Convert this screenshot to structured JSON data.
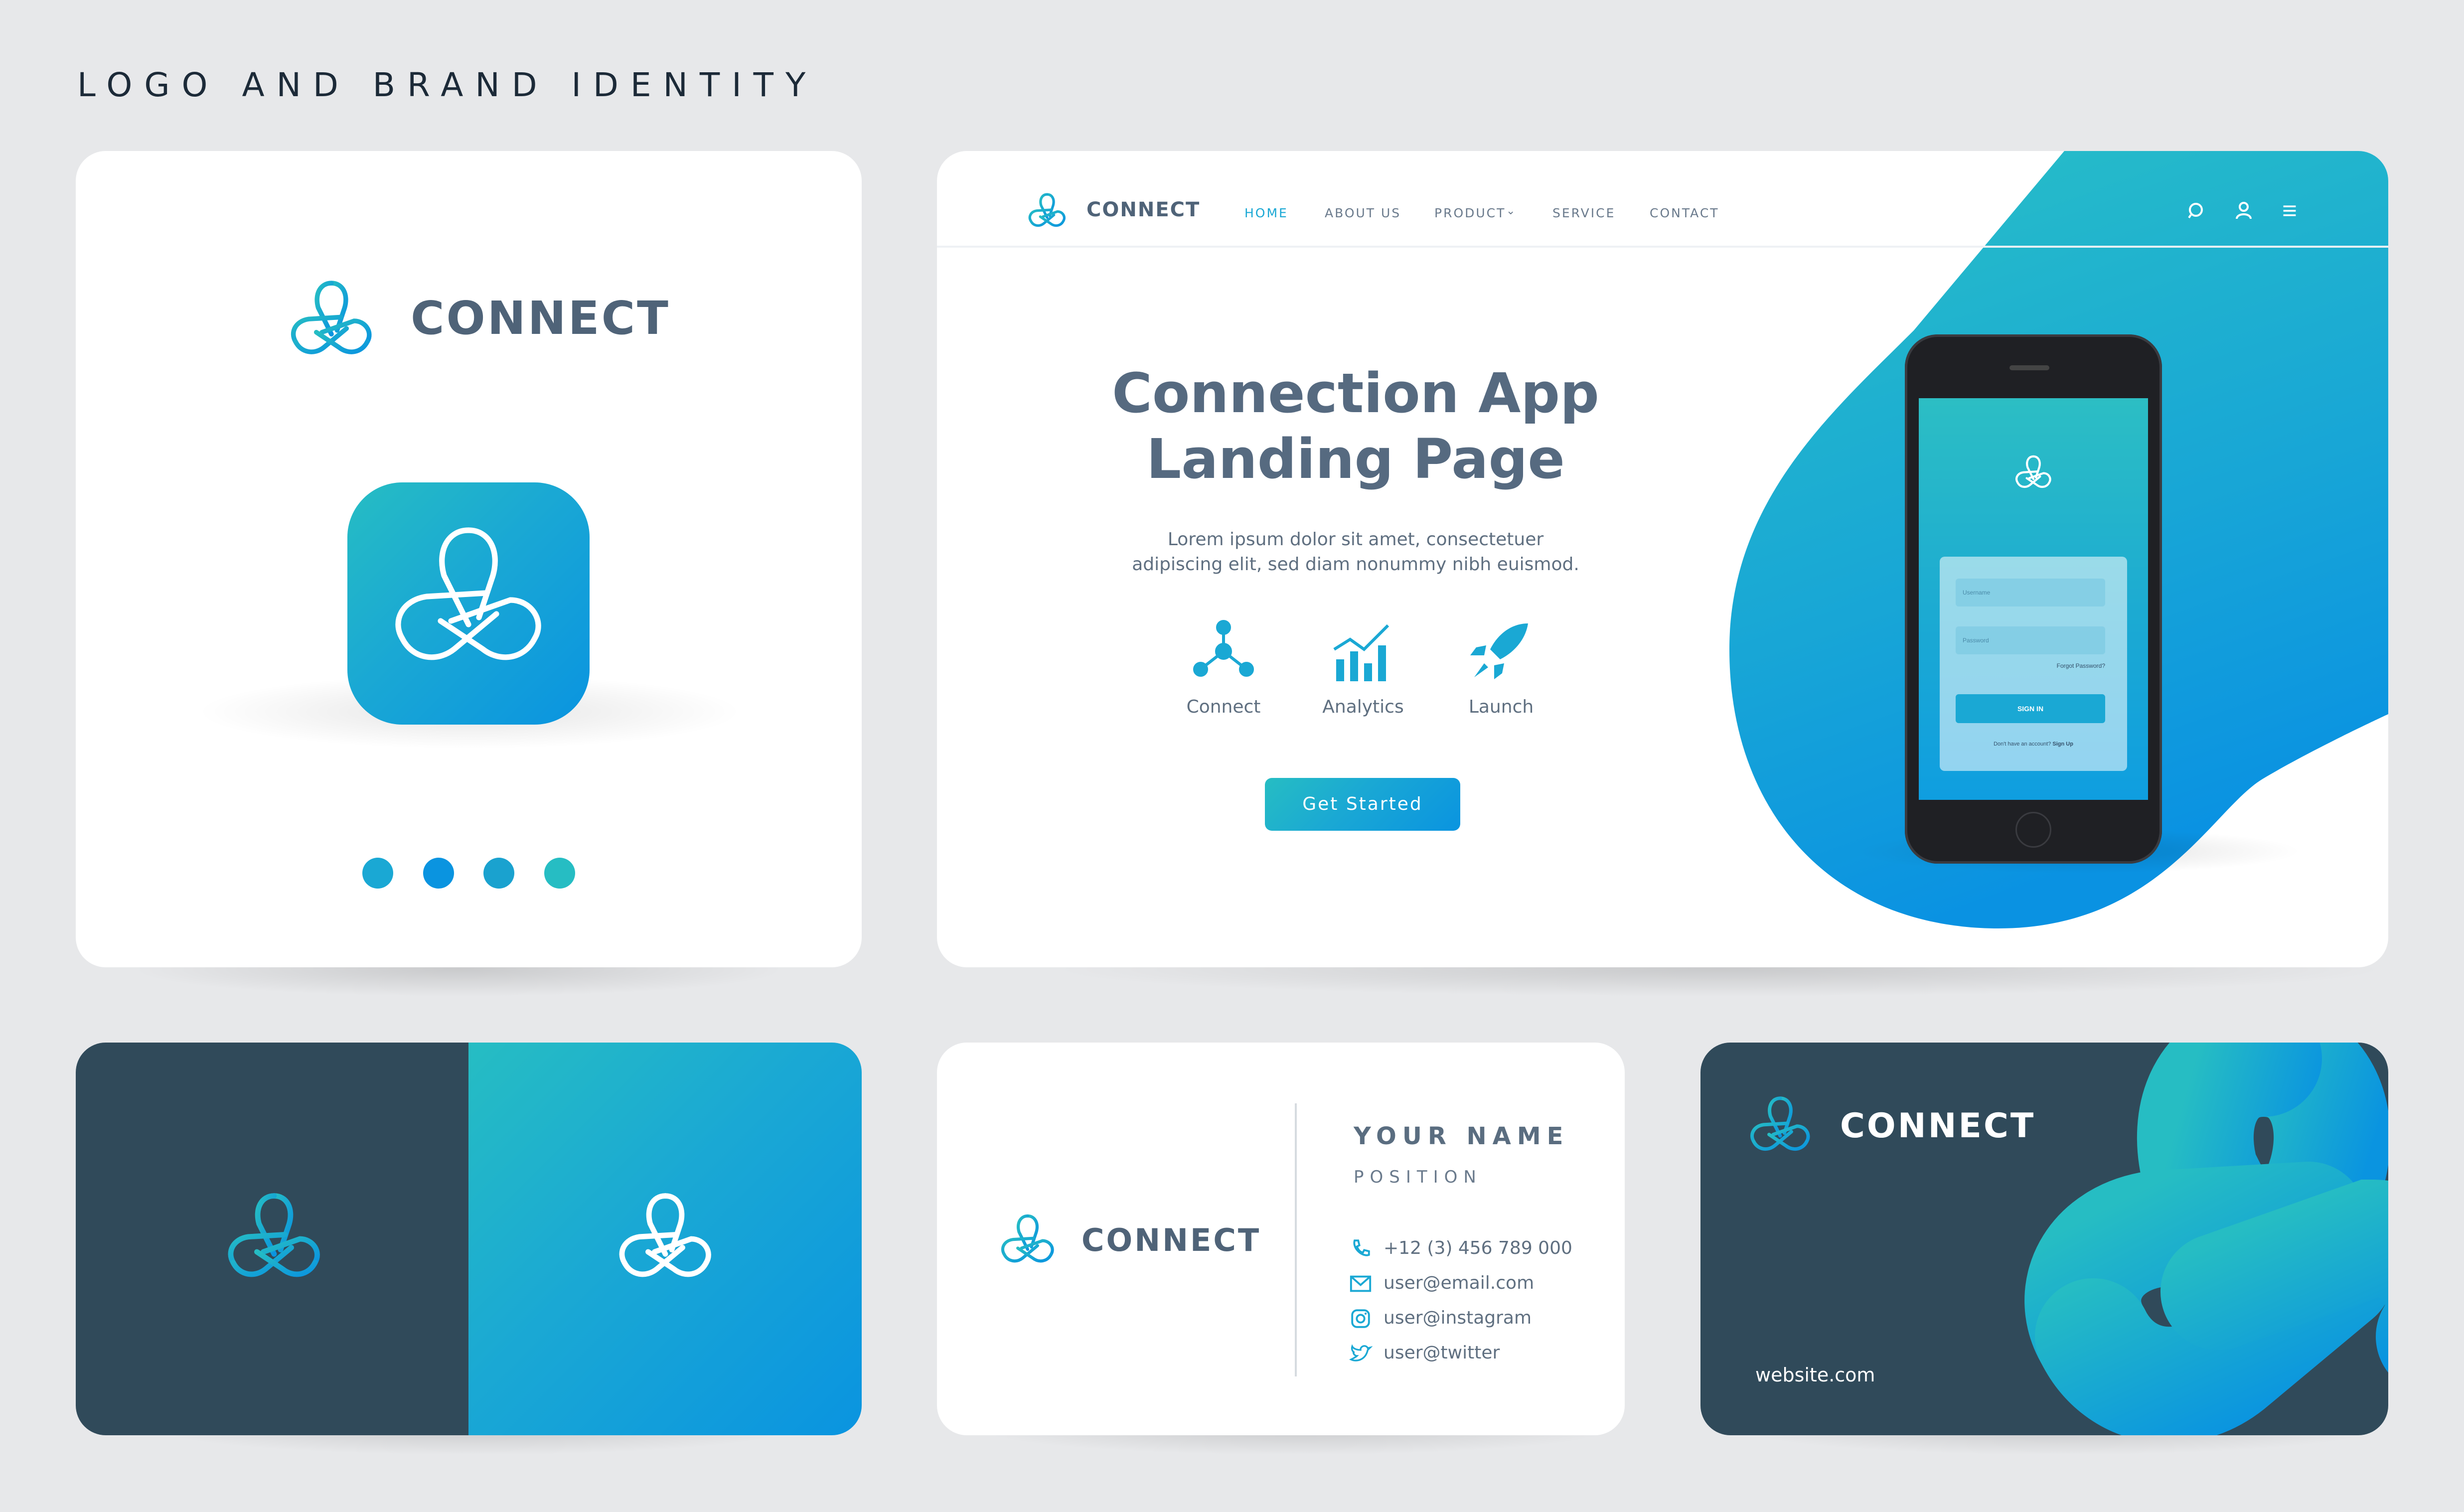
{
  "heading": "LOGO AND BRAND IDENTITY",
  "brand": {
    "name": "CONNECT",
    "colors": {
      "accent": "#1aa8d4",
      "teal": "#26bdc3",
      "blue": "#0a94e0",
      "dark": "#304a5a",
      "text": "#4f6378"
    }
  },
  "palette_dots": [
    "#1aa8d4",
    "#0a94e0",
    "#1aa2cf",
    "#26bdc3"
  ],
  "website": {
    "nav": {
      "home": "HOME",
      "about": "ABOUT US",
      "product": "PRODUCT",
      "service": "SERVICE",
      "contact": "CONTACT"
    },
    "hero_title_1": "Connection App",
    "hero_title_2": "Landing Page",
    "hero_text_1": "Lorem ipsum dolor sit amet, consectetuer",
    "hero_text_2": "adipiscing elit, sed diam nonummy nibh euismod.",
    "features": [
      {
        "label": "Connect",
        "icon": "network-icon"
      },
      {
        "label": "Analytics",
        "icon": "chart-icon"
      },
      {
        "label": "Launch",
        "icon": "rocket-icon"
      }
    ],
    "cta": "Get Started",
    "phone": {
      "username_placeholder": "Username",
      "password_placeholder": "Password",
      "forgot": "Forgot Password?",
      "sign_in": "SIGN IN",
      "signup_prompt": "Don't have an account?",
      "signup_link": "Sign Up"
    }
  },
  "card": {
    "name": "YOUR NAME",
    "position": "POSITION",
    "phone": "+12 (3) 456 789 000",
    "email": "user@email.com",
    "instagram": "user@instagram",
    "twitter": "user@twitter",
    "website": "website.com"
  }
}
